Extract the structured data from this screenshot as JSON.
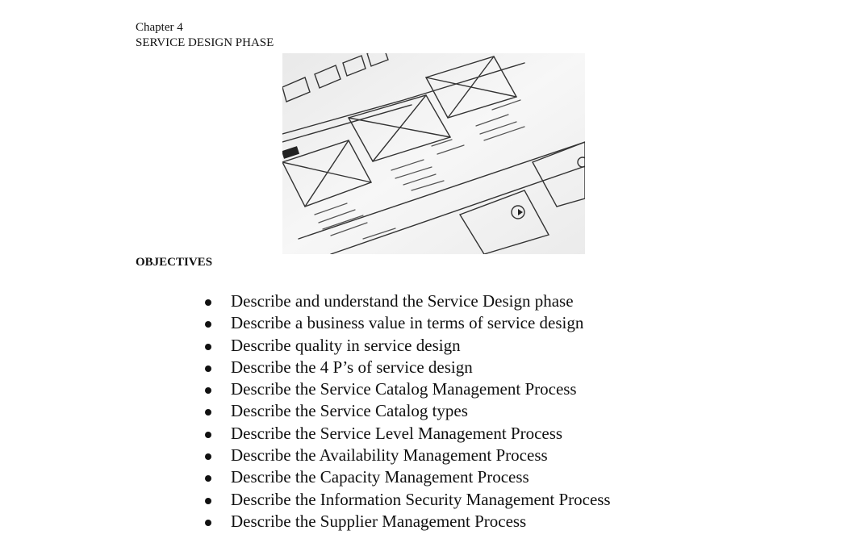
{
  "header": {
    "chapter": "Chapter 4",
    "title": "SERVICE DESIGN PHASE"
  },
  "image": {
    "description_icon": "wireframe-sketch-image"
  },
  "objectives": {
    "heading": "OBJECTIVES",
    "items": [
      "Describe and understand the Service Design phase",
      "Describe a business value in terms of service design",
      "Describe quality in service design",
      "Describe the 4 P’s of service design",
      "Describe the Service Catalog Management Process",
      "Describe the Service Catalog types",
      "Describe the Service Level Management Process",
      "Describe the Availability Management Process",
      "Describe the Capacity Management Process",
      "Describe the Information Security Management Process",
      "Describe the Supplier Management Process"
    ]
  }
}
